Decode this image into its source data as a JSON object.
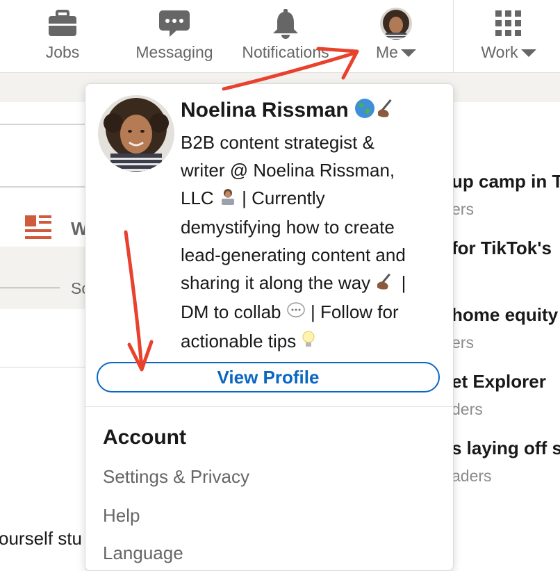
{
  "nav": {
    "jobs": "Jobs",
    "messaging": "Messaging",
    "notifications": "Notifications",
    "me": "Me",
    "work": "Work"
  },
  "background": {
    "left_partial_1": "W",
    "left_partial_2": "So",
    "left_partial_3": "ourself stu",
    "right_items": [
      {
        "title": "up camp in T",
        "sub": "ers"
      },
      {
        "title": "for TikTok's",
        "sub": ""
      },
      {
        "title": "home equity",
        "sub": "ers"
      },
      {
        "title": "et Explorer",
        "sub": "ders"
      },
      {
        "title": "s laying off s",
        "sub": "aders"
      }
    ]
  },
  "profile": {
    "name": "Noelina Rissman",
    "headline": [
      "B2B content strategist &",
      "writer @ Noelina Rissman,",
      "LLC",
      "| Currently",
      "demystifying how to create",
      "lead-generating content and",
      "sharing it along the way",
      "|",
      "DM to collab",
      "| Follow for",
      "actionable tips"
    ],
    "view_profile": "View Profile"
  },
  "account": {
    "title": "Account",
    "items": [
      "Settings & Privacy",
      "Help",
      "Language"
    ]
  },
  "colors": {
    "accent": "#0a66c2",
    "annotation": "#e8412d",
    "nav_icon": "#666666"
  }
}
